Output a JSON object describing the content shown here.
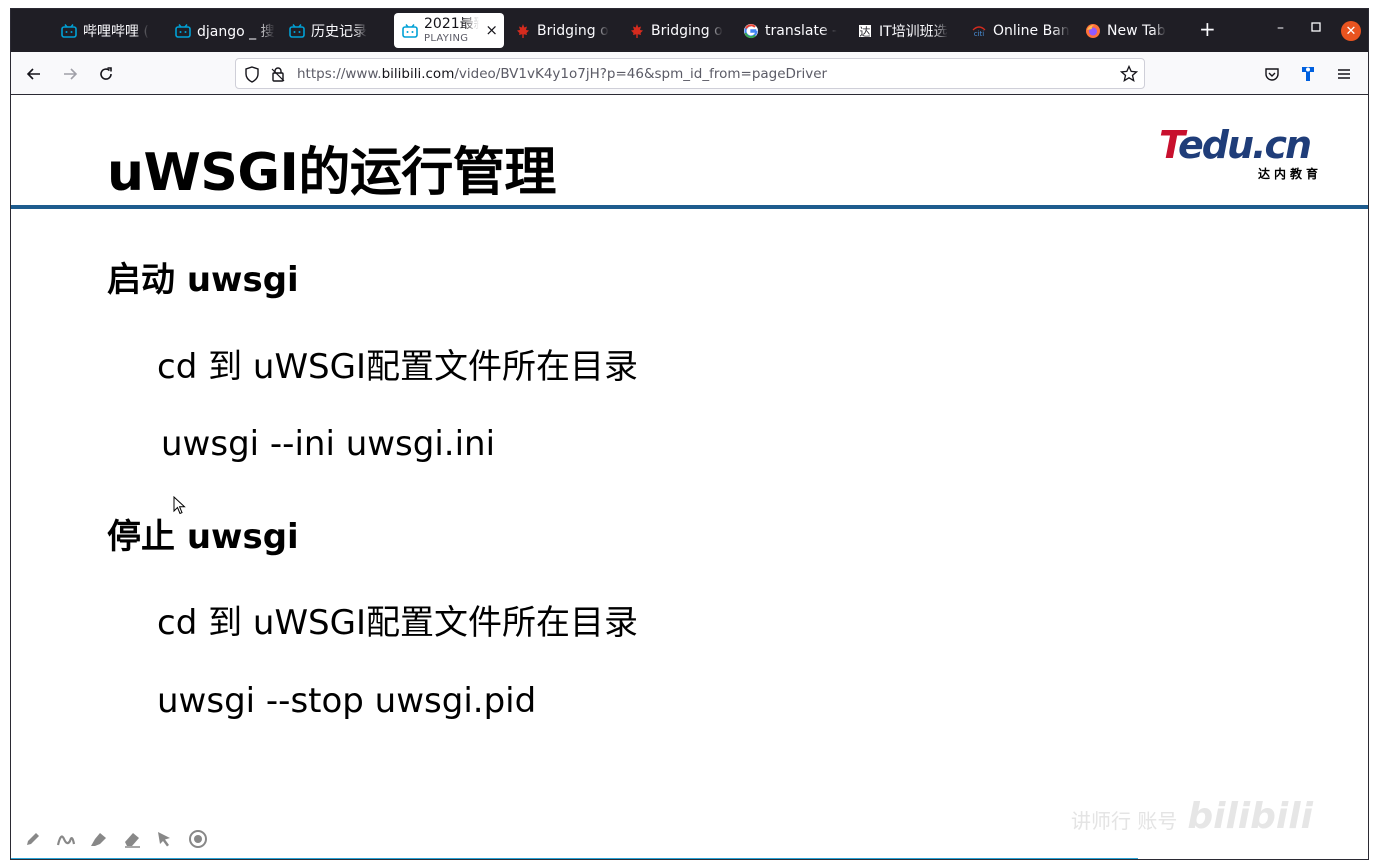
{
  "browser": {
    "tabs": [
      {
        "label": "哔哩哔哩 (",
        "icon": "bilibili-icon"
      },
      {
        "label": "django _ 搜",
        "icon": "bilibili-icon"
      },
      {
        "label": "历史记录",
        "icon": "bilibili-icon"
      },
      {
        "label": "2021最新",
        "sublabel": "PLAYING",
        "icon": "bilibili-icon",
        "active": true
      },
      {
        "label": "Bridging o",
        "icon": "maple-leaf-icon"
      },
      {
        "label": "Bridging o",
        "icon": "maple-leaf-icon"
      },
      {
        "label": "translate -",
        "icon": "google-icon"
      },
      {
        "label": "IT培训班选",
        "icon": "tarena-icon"
      },
      {
        "label": "Online Ban",
        "icon": "citi-icon"
      },
      {
        "label": "New Tab",
        "icon": "firefox-icon"
      }
    ],
    "url_prefix": "https://www.",
    "url_host": "bilibili.com",
    "url_path": "/video/BV1vK4y1o7jH?p=46&spm_id_from=pageDriver",
    "colors": {
      "tabstrip": "#1f1e25",
      "navbar": "#f9f9fb",
      "close": "#e95420"
    }
  },
  "slide": {
    "title": "uWSGI的运行管理",
    "logo": {
      "main_t": "T",
      "main_rest": "edu.cn",
      "sub": "达内教育"
    },
    "sections": [
      {
        "heading": "启动 uwsgi",
        "lines": [
          "cd 到 uWSGI配置文件所在目录",
          "uwsgi --ini uwsgi.ini"
        ]
      },
      {
        "heading": "停止 uwsgi",
        "lines": [
          "cd 到 uWSGI配置文件所在目录",
          "uwsgi --stop uwsgi.pid"
        ]
      }
    ],
    "tools": [
      "pen-icon",
      "curve-icon",
      "highlighter-icon",
      "eraser-icon",
      "pointer-icon",
      "record-icon"
    ],
    "watermark": {
      "text": "讲师行 账号",
      "brand": "bilibili"
    },
    "colors": {
      "rule": "#1e5c8e",
      "logo_red": "#c8102e",
      "logo_blue": "#1f3d79"
    }
  }
}
